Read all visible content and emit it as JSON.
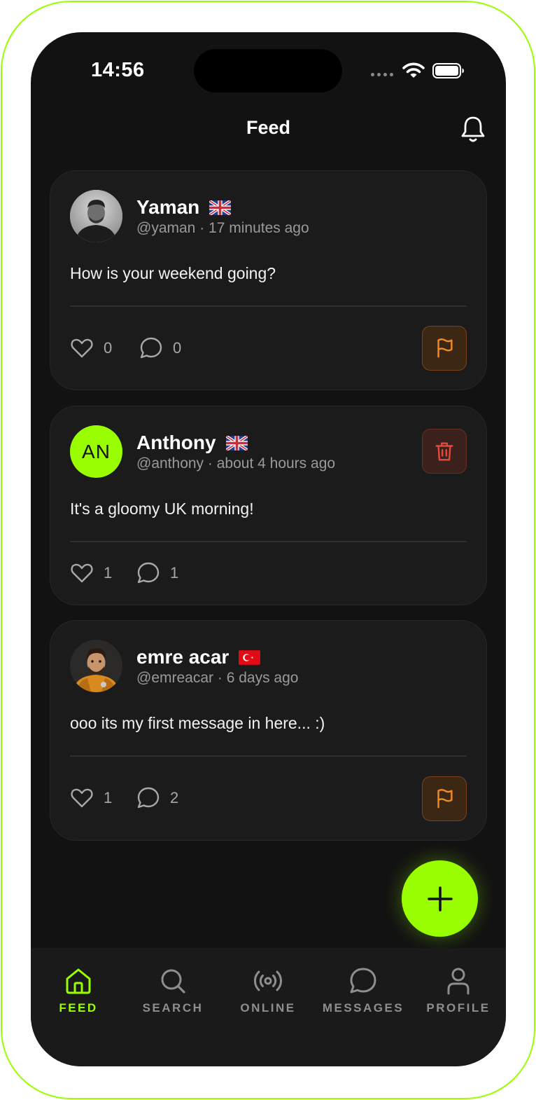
{
  "status_bar": {
    "time": "14:56"
  },
  "header": {
    "title": "Feed",
    "icon": "bell-icon"
  },
  "colors": {
    "accent": "#99ff00",
    "background": "#121212",
    "card": "#1b1b1b",
    "report": "#f08a24",
    "delete": "#e8453c"
  },
  "posts": [
    {
      "author": "Yaman",
      "flag": "gb",
      "handle": "@yaman",
      "time": "17 minutes ago",
      "separator": "·",
      "text": "How is your weekend going?",
      "likes": "0",
      "comments": "0",
      "action": "report"
    },
    {
      "author": "Anthony",
      "initials": "AN",
      "flag": "gb",
      "handle": "@anthony",
      "time": "about 4 hours ago",
      "separator": "·",
      "text": "It's a gloomy UK morning!",
      "likes": "1",
      "comments": "1",
      "action": "delete"
    },
    {
      "author": "emre acar",
      "flag": "tr",
      "handle": "@emreacar",
      "time": "6 days ago",
      "separator": "·",
      "text": "ooo its my first message in here... :)",
      "likes": "1",
      "comments": "2",
      "action": "report"
    }
  ],
  "tabs": [
    {
      "label": "FEED",
      "icon": "home-icon",
      "active": true
    },
    {
      "label": "SEARCH",
      "icon": "search-icon",
      "active": false
    },
    {
      "label": "ONLINE",
      "icon": "broadcast-icon",
      "active": false
    },
    {
      "label": "MESSAGES",
      "icon": "chat-bubble-icon",
      "active": false
    },
    {
      "label": "PROFILE",
      "icon": "user-icon",
      "active": false
    }
  ]
}
